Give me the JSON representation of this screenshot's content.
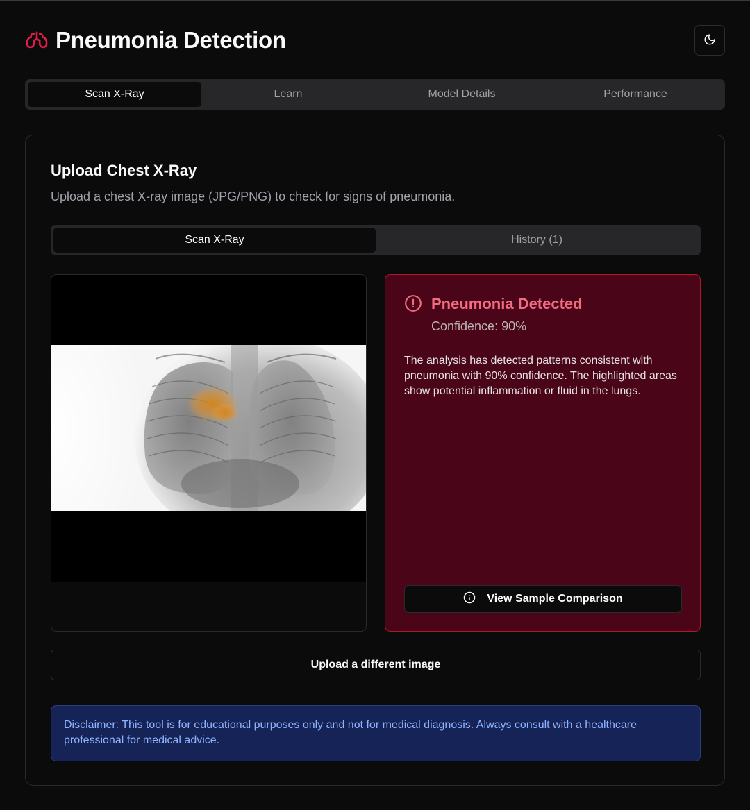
{
  "header": {
    "app_title": "Pneumonia Detection",
    "brand_icon": "lungs-icon",
    "theme_icon": "moon-icon"
  },
  "main_tabs": [
    {
      "label": "Scan X-Ray",
      "active": true
    },
    {
      "label": "Learn",
      "active": false
    },
    {
      "label": "Model Details",
      "active": false
    },
    {
      "label": "Performance",
      "active": false
    }
  ],
  "upload_card": {
    "title": "Upload Chest X-Ray",
    "description": "Upload a chest X-ray image (JPG/PNG) to check for signs of pneumonia.",
    "sub_tabs": [
      {
        "label": "Scan X-Ray",
        "active": true
      },
      {
        "label": "History (1)",
        "active": false
      }
    ]
  },
  "result": {
    "title": "Pneumonia Detected",
    "confidence": "Confidence: 90%",
    "description": "The analysis has detected patterns consistent with pneumonia with 90% confidence. The highlighted areas show potential inflammation or fluid in the lungs.",
    "compare_button": "View Sample Comparison",
    "icon": "alert-circle-icon",
    "compare_icon": "info-icon"
  },
  "upload_button": "Upload a different image",
  "disclaimer": "Disclaimer: This tool is for educational purposes only and not for medical diagnosis. Always consult with a healthcare professional for medical advice.",
  "colors": {
    "background": "#0b0b0c",
    "accent_red": "#e11d48",
    "result_bg": "#4a0519",
    "disclaimer_bg": "#162356",
    "disclaimer_text": "#8fb4ff"
  }
}
